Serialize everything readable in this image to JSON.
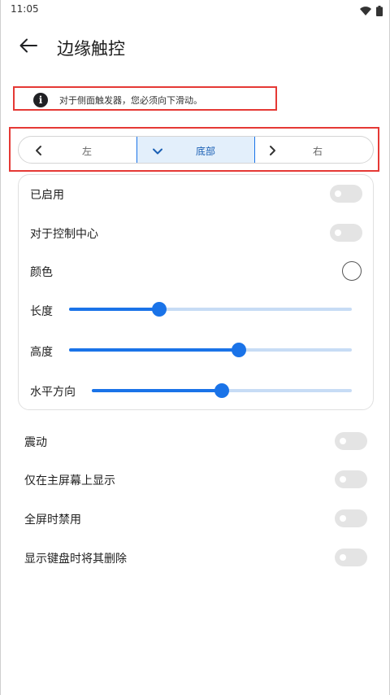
{
  "status_bar": {
    "time": "11:05",
    "icons": [
      "wifi-icon",
      "battery-icon"
    ]
  },
  "app_bar": {
    "back_icon": "arrow-left-icon",
    "title": "边缘触控"
  },
  "notice": {
    "icon": "info-icon",
    "text": "对于侧面触发器，您必须向下滑动。"
  },
  "edge_selector": {
    "options": [
      {
        "label": "左",
        "icon": "chevron-left-icon",
        "selected": false
      },
      {
        "label": "底部",
        "icon": "chevron-down-icon",
        "selected": true
      },
      {
        "label": "右",
        "icon": "chevron-right-icon",
        "selected": false
      }
    ]
  },
  "card": {
    "enabled": {
      "label": "已启用",
      "on": false
    },
    "control_center": {
      "label": "对于控制中心",
      "on": false
    },
    "color": {
      "label": "颜色",
      "value": "#ffffff"
    },
    "length": {
      "label": "长度",
      "value_percent": 32
    },
    "height": {
      "label": "高度",
      "value_percent": 60
    },
    "horizontal": {
      "label": "水平方向",
      "value_percent": 50
    }
  },
  "settings": {
    "vibration": {
      "label": "震动",
      "on": false
    },
    "home_only": {
      "label": "仅在主屏幕上显示",
      "on": false
    },
    "fullscreen_disable": {
      "label": "全屏时禁用",
      "on": false
    },
    "keyboard_remove": {
      "label": "显示键盘时将其删除",
      "on": false
    }
  },
  "colors": {
    "accent": "#1a73e8",
    "track": "#c7dcf5",
    "toggle_off": "#e4e4e4",
    "highlight_box": "#e53935",
    "selected_segment_bg": "#e3effb"
  }
}
